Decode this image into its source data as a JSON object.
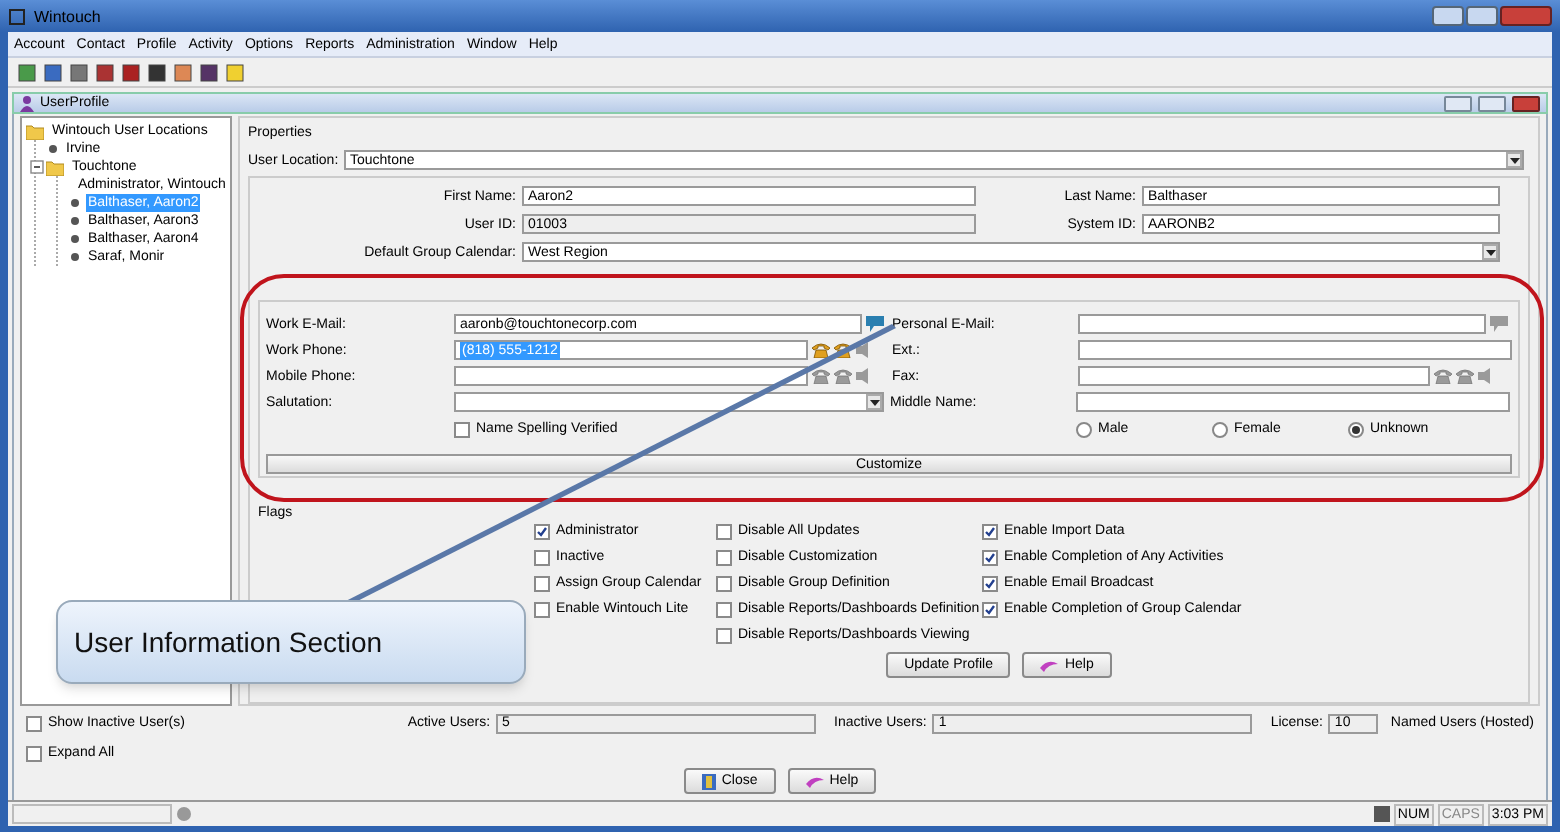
{
  "window": {
    "title": "Wintouch"
  },
  "menu": [
    "Account",
    "Contact",
    "Profile",
    "Activity",
    "Options",
    "Reports",
    "Administration",
    "Window",
    "Help"
  ],
  "inner_window": {
    "title": "UserProfile"
  },
  "tree": [
    {
      "label": "Wintouch User Locations",
      "kind": "folder",
      "selected": false,
      "children": [
        {
          "label": "Irvine",
          "kind": "leaf",
          "selected": false
        },
        {
          "label": "Touchtone",
          "kind": "folder",
          "selected": false,
          "expanded": true,
          "children": [
            {
              "label": "Administrator, Wintouch",
              "kind": "leaf",
              "selected": false
            },
            {
              "label": "Balthaser, Aaron2",
              "kind": "leaf",
              "selected": true
            },
            {
              "label": "Balthaser, Aaron3",
              "kind": "leaf",
              "selected": false
            },
            {
              "label": "Balthaser, Aaron4",
              "kind": "leaf",
              "selected": false
            },
            {
              "label": "Saraf, Monir",
              "kind": "leaf",
              "selected": false
            }
          ]
        }
      ]
    }
  ],
  "properties": {
    "title": "Properties",
    "user_location": {
      "label": "User Location:",
      "value": "Touchtone"
    },
    "first_name": {
      "label": "First Name:",
      "value": "Aaron2"
    },
    "last_name": {
      "label": "Last Name:",
      "value": "Balthaser"
    },
    "user_id": {
      "label": "User ID:",
      "value": "01003"
    },
    "system_id": {
      "label": "System ID:",
      "value": "AARONB2"
    },
    "default_group_calendar": {
      "label": "Default Group Calendar:",
      "value": "West Region"
    }
  },
  "contact": {
    "work_email": {
      "label": "Work E-Mail:",
      "value": "aaronb@touchtonecorp.com"
    },
    "personal_email": {
      "label": "Personal E-Mail:"
    },
    "work_phone": {
      "label": "Work Phone:",
      "value": "(818) 555-1212",
      "selected": true
    },
    "ext": {
      "label": "Ext.:"
    },
    "mobile_phone": {
      "label": "Mobile Phone:"
    },
    "fax": {
      "label": "Fax:"
    },
    "salutation": {
      "label": "Salutation:"
    },
    "middle_name": {
      "label": "Middle Name:"
    },
    "name_spelling": {
      "label": "Name Spelling Verified",
      "checked": false
    },
    "gender": [
      {
        "label": "Male",
        "selected": false
      },
      {
        "label": "Female",
        "selected": false
      },
      {
        "label": "Unknown",
        "selected": true
      }
    ],
    "customize": "Customize"
  },
  "flags": {
    "title": "Flags",
    "columns": [
      [
        {
          "label": "Administrator",
          "checked": true
        },
        {
          "label": "Inactive",
          "checked": false
        },
        {
          "label": "Assign Group Calendar",
          "checked": false
        },
        {
          "label": "Enable Wintouch Lite",
          "checked": false
        }
      ],
      [
        {
          "label": "Disable All Updates",
          "checked": false
        },
        {
          "label": "Disable Customization",
          "checked": false
        },
        {
          "label": "Disable Group Definition",
          "checked": false
        },
        {
          "label": "Disable Reports/Dashboards Definition",
          "checked": false
        },
        {
          "label": "Disable Reports/Dashboards Viewing",
          "checked": false
        }
      ],
      [
        {
          "label": "Enable Import Data",
          "checked": true
        },
        {
          "label": "Enable Completion of Any Activities",
          "checked": true
        },
        {
          "label": "Enable Email Broadcast",
          "checked": true
        },
        {
          "label": "Enable Completion of Group Calendar",
          "checked": true
        }
      ]
    ]
  },
  "profile_buttons": [
    "Update Profile",
    "Help"
  ],
  "footer": {
    "show_inactive": {
      "label": "Show Inactive User(s)",
      "checked": false
    },
    "expand_all": {
      "label": "Expand All",
      "checked": false
    },
    "active_users": {
      "label": "Active Users:",
      "value": "5"
    },
    "inactive_users": {
      "label": "Inactive Users:",
      "value": "1"
    },
    "license": {
      "label": "License:",
      "value": "10"
    },
    "license_note": "Named Users (Hosted)"
  },
  "dialog_buttons": [
    "Close",
    "Help"
  ],
  "status_bar": {
    "num": "NUM",
    "caps": "CAPS",
    "time": "3:03 PM"
  },
  "callout": "User Information Section"
}
